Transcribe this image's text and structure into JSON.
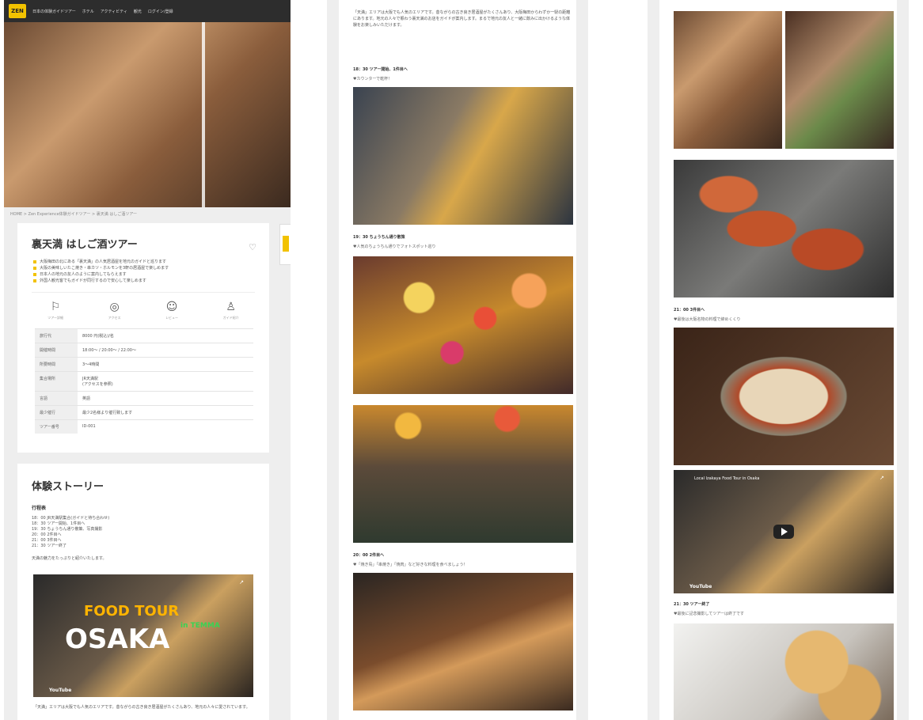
{
  "nav": {
    "logo": "ZEN",
    "items": [
      "日本の体験ガイドツアー",
      "ホテル",
      "アクティビティ",
      "観光",
      "ログイン/登録"
    ]
  },
  "breadcrumb": "HOME > Zen Experience体験ガイドツアー > 裏天満 はしご酒ツアー",
  "tour": {
    "title": "裏天満 はしご酒ツアー",
    "bullets": [
      "大阪梅田の北にある「裏天満」の人気居酒屋を地元のガイドと巡ります",
      "大阪の美味しいたこ焼き・串カツ・ホルモンを3軒の居酒屋で楽しめます",
      "日本人の地元の友人のように案内してもらえます",
      "外国人観光客でもガイドが同行するので安心して楽しめます"
    ],
    "icons": [
      {
        "name": "flag-icon",
        "symbol": "⚐",
        "label": "ツアー詳細"
      },
      {
        "name": "map-pin-icon",
        "symbol": "◎",
        "label": "アクセス"
      },
      {
        "name": "chat-icon",
        "symbol": "☺",
        "label": "レビュー"
      },
      {
        "name": "guide-icon",
        "symbol": "♙",
        "label": "ガイド紹介"
      }
    ],
    "info": [
      {
        "k": "旅行代",
        "v": "8000 円(税込)/名"
      },
      {
        "k": "開催時間",
        "v": "18:00〜 / 20:00〜 / 22:00〜"
      },
      {
        "k": "所要時間",
        "v": "3〜4時間"
      },
      {
        "k": "集合場所",
        "v": "JR天満駅\n(アクセスを参照)"
      },
      {
        "k": "言語",
        "v": "英語"
      },
      {
        "k": "最少催行",
        "v": "最少2名様より催行致します"
      },
      {
        "k": "ツアー番号",
        "v": "ID-001"
      }
    ]
  },
  "story": {
    "title": "体験ストーリー",
    "schedule_heading": "行程表",
    "schedule": "18：00 JR天満駅集合(ガイドと待ち合わせ)\n18：30 ツアー開始、1件目へ\n19：30 ちょうちん通り散策、写真撮影\n20：00 2件目へ\n21：00 3件目へ\n21：30 ツアー終了",
    "note": "天満の魅力をたっぷりと紹介いたします。",
    "video": {
      "line1": "FOOD TOUR",
      "line2": "OSAKA",
      "tag": "in TEMMA",
      "source": "YouTube"
    },
    "paragraph": "「天満」エリアは大阪でも人気のエリアです。昔ながらの古き良き居酒屋がたくさんあり、地元の人々に愛されています。"
  },
  "col2": {
    "intro": "「天満」エリアは大阪でも人気のエリアです。昔ながらの古き良き居酒屋がたくさんあり、大阪梅田からわずか一駅の距離にあります。地元の人々で賑わう裏天満のお店をガイドが案内します。まるで地元の友人と一緒に飲みに出かけるような体験をお楽しみいただけます。",
    "sections": [
      {
        "cap": "18：30 ツアー開始、1件目へ",
        "sub": "♥カウンターで乾杯！"
      },
      {
        "cap": "19：30 ちょうちん通り散策",
        "sub": "♥人気のちょうちん通りでフォトスポット巡り"
      },
      {
        "cap": "20：00 2件目へ",
        "sub": "♥「焼き鳥」「串焼き」「焼肉」など好きな料理を食べましょう！"
      }
    ]
  },
  "col3": {
    "sections": [
      {
        "cap": "21：00 3件目へ",
        "sub": "♥最後は大阪名物の料理で締めくくり"
      },
      {
        "cap": "21：30 ツアー終了",
        "sub": "♥最後に記念撮影してツアーは終了です"
      }
    ],
    "video": {
      "title": "Local Izakaya Food Tour in Osaka",
      "source": "YouTube"
    }
  }
}
